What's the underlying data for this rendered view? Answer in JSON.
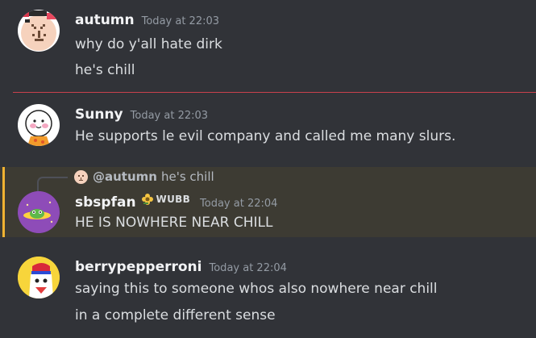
{
  "messages": [
    {
      "username": "autumn",
      "timestamp": "Today at 22:03",
      "lines": [
        "why do y'all hate dirk",
        "he's chill"
      ]
    },
    {
      "username": "Sunny",
      "timestamp": "Today at 22:03",
      "lines": [
        "He supports le evil company and called me many slurs."
      ]
    },
    {
      "username": "sbspfan",
      "role_tag": "WUBB",
      "timestamp": "Today at 22:04",
      "reply": {
        "mention": "@autumn",
        "text": "he's chill"
      },
      "lines": [
        "HE IS NOWHERE NEAR CHILL"
      ]
    },
    {
      "username": "berrypepperroni",
      "timestamp": "Today at 22:04",
      "lines": [
        "saying this to someone whos also nowhere near chill",
        "in a complete different sense"
      ]
    }
  ],
  "colors": {
    "background": "#313338",
    "username": "#f2f3f5",
    "timestamp": "#949ba4",
    "new_messages_divider": "#c9414c",
    "mention_highlight_bg": "#3d3b33",
    "mention_highlight_bar": "#f0b232"
  },
  "icons": {
    "role_icon": "flower-icon"
  }
}
